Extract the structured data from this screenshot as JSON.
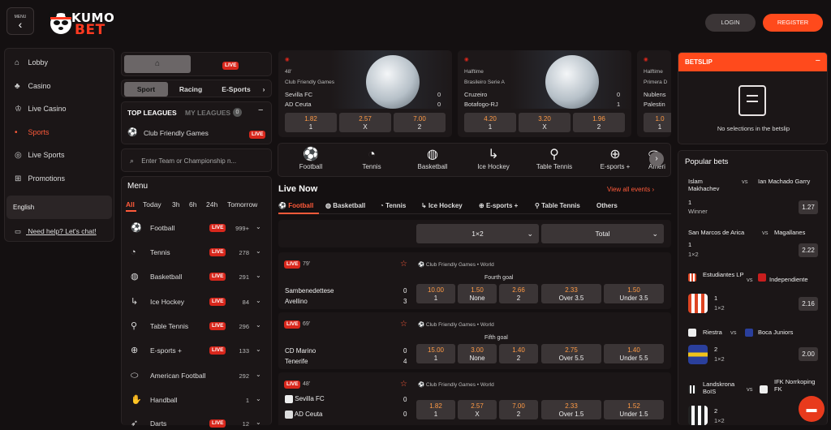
{
  "header": {
    "menu_label": "MENU",
    "logo_top": "KUMO",
    "logo_bottom": "BET",
    "login": "LOGIN",
    "register": "REGISTER"
  },
  "sidebar": {
    "items": [
      {
        "label": "Lobby",
        "icon": "home-icon"
      },
      {
        "label": "Casino",
        "icon": "casino-icon"
      },
      {
        "label": "Live Casino",
        "icon": "live-casino-icon"
      },
      {
        "label": "Sports",
        "icon": "sports-icon",
        "active": true
      },
      {
        "label": "Live Sports",
        "icon": "live-sports-icon"
      },
      {
        "label": "Promotions",
        "icon": "gift-icon"
      }
    ],
    "language": "English",
    "help": "Need help? Let's chat!"
  },
  "switcher": {
    "live": "LIVE"
  },
  "sport_tabs": [
    "Sport",
    "Racing",
    "E-Sports"
  ],
  "leagues": {
    "top": "TOP LEAGUES",
    "my": "MY LEAGUES",
    "my_count": "0",
    "item": "Club Friendly Games",
    "item_live": "LIVE"
  },
  "search": {
    "placeholder": "Enter Team or Championship n..."
  },
  "menu": {
    "title": "Menu",
    "periods": [
      "All",
      "Today",
      "3h",
      "6h",
      "24h",
      "Tomorrow"
    ],
    "live_label": "LIVE",
    "sports": [
      {
        "name": "Football",
        "icon": "football-icon",
        "live": true,
        "count": "999+"
      },
      {
        "name": "Tennis",
        "icon": "tennis-icon",
        "live": true,
        "count": "278"
      },
      {
        "name": "Basketball",
        "icon": "basketball-icon",
        "live": true,
        "count": "291"
      },
      {
        "name": "Ice Hockey",
        "icon": "ice-hockey-icon",
        "live": true,
        "count": "84"
      },
      {
        "name": "Table Tennis",
        "icon": "table-tennis-icon",
        "live": true,
        "count": "296"
      },
      {
        "name": "E-sports +",
        "icon": "esports-icon",
        "live": true,
        "count": "133"
      },
      {
        "name": "American Football",
        "icon": "american-football-icon",
        "live": false,
        "count": "292"
      },
      {
        "name": "Handball",
        "icon": "handball-icon",
        "live": false,
        "count": "1"
      },
      {
        "name": "Darts",
        "icon": "darts-icon",
        "live": true,
        "count": "12"
      }
    ]
  },
  "featured": [
    {
      "minute": "48'",
      "league": "Club Friendly Games",
      "home": "Sevilla FC",
      "away": "AD Ceuta",
      "home_score": "0",
      "away_score": "0",
      "odds": [
        {
          "v": "1.82",
          "l": "1"
        },
        {
          "v": "2.57",
          "l": "X"
        },
        {
          "v": "7.00",
          "l": "2"
        }
      ]
    },
    {
      "minute": "Halftime",
      "league": "Brasileiro Serie A",
      "home": "Cruzeiro",
      "away": "Botafogo-RJ",
      "home_score": "0",
      "away_score": "1",
      "odds": [
        {
          "v": "4.20",
          "l": "1"
        },
        {
          "v": "3.20",
          "l": "X"
        },
        {
          "v": "1.96",
          "l": "2"
        }
      ]
    },
    {
      "minute": "Halftime",
      "league": "Primera D",
      "home": "Nublens",
      "away": "Palestin",
      "home_score": "",
      "away_score": "",
      "odds": [
        {
          "v": "1.0",
          "l": "1"
        }
      ]
    }
  ],
  "sports_strip": [
    {
      "name": "Football",
      "icon": "football-icon"
    },
    {
      "name": "Tennis",
      "icon": "tennis-icon"
    },
    {
      "name": "Basketball",
      "icon": "basketball-icon"
    },
    {
      "name": "Ice Hockey",
      "icon": "ice-hockey-icon"
    },
    {
      "name": "Table Tennis",
      "icon": "table-tennis-icon"
    },
    {
      "name": "E-sports +",
      "icon": "esports-icon"
    },
    {
      "name": "Ameri",
      "icon": "american-football-icon"
    }
  ],
  "live_now": {
    "title": "Live Now",
    "view_all": "View all events",
    "tabs": [
      "Football",
      "Basketball",
      "Tennis",
      "Ice Hockey",
      "E-sports +",
      "Table Tennis",
      "Others"
    ],
    "market1": "1×2",
    "market2": "Total"
  },
  "events": [
    {
      "live": "LIVE",
      "minute": "79'",
      "league": "Club Friendly Games • World",
      "market": "Fourth goal",
      "home": "Sambenedettese",
      "away": "Avellino",
      "home_score": "0",
      "away_score": "3",
      "odds": [
        {
          "v": "10.00",
          "l": "1"
        },
        {
          "v": "1.50",
          "l": "None"
        },
        {
          "v": "2.66",
          "l": "2"
        },
        {
          "v": "2.33",
          "l": "Over 3.5"
        },
        {
          "v": "1.50",
          "l": "Under 3.5"
        }
      ]
    },
    {
      "live": "LIVE",
      "minute": "69'",
      "league": "Club Friendly Games • World",
      "market": "Fifth goal",
      "home": "CD Marino",
      "away": "Tenerife",
      "home_score": "0",
      "away_score": "4",
      "odds": [
        {
          "v": "15.00",
          "l": "1"
        },
        {
          "v": "3.00",
          "l": "None"
        },
        {
          "v": "1.40",
          "l": "2"
        },
        {
          "v": "2.75",
          "l": "Over 5.5"
        },
        {
          "v": "1.40",
          "l": "Under 5.5"
        }
      ]
    },
    {
      "live": "LIVE",
      "minute": "48'",
      "league": "Club Friendly Games • World",
      "market": "",
      "home": "Sevilla FC",
      "away": "AD Ceuta",
      "home_score": "0",
      "away_score": "0",
      "odds": [
        {
          "v": "1.82",
          "l": "1"
        },
        {
          "v": "2.57",
          "l": "X"
        },
        {
          "v": "7.00",
          "l": "2"
        },
        {
          "v": "2.33",
          "l": "Over 1.5"
        },
        {
          "v": "1.52",
          "l": "Under 1.5"
        }
      ]
    }
  ],
  "betslip": {
    "title": "BETSLIP",
    "empty": "No selections in the betslip"
  },
  "popular": {
    "title": "Popular bets",
    "bets": [
      {
        "home": "Islam Makhachev",
        "vs": "vs",
        "away": "Ian Machado Garry",
        "pick": "1",
        "market": "Winner",
        "odd": "1.27"
      },
      {
        "home": "San Marcos de Arica",
        "vs": "vs",
        "away": "Magallanes",
        "pick": "1",
        "market": "1×2",
        "odd": "2.22"
      },
      {
        "home": "Estudiantes LP",
        "vs": "vs",
        "away": "Independiente",
        "pick": "1",
        "market": "1×2",
        "odd": "2.16"
      },
      {
        "home": "Riestra",
        "vs": "vs",
        "away": "Boca Juniors",
        "pick": "2",
        "market": "1×2",
        "odd": "2.00"
      },
      {
        "home": "Landskrona BoIS",
        "vs": "vs",
        "away": "IFK Norrkoping FK",
        "pick": "2",
        "market": "1×2",
        "odd": ""
      }
    ]
  },
  "colors": {
    "accent": "#ff4a1c",
    "live": "#d8271c",
    "odds": "#ff9a45"
  }
}
